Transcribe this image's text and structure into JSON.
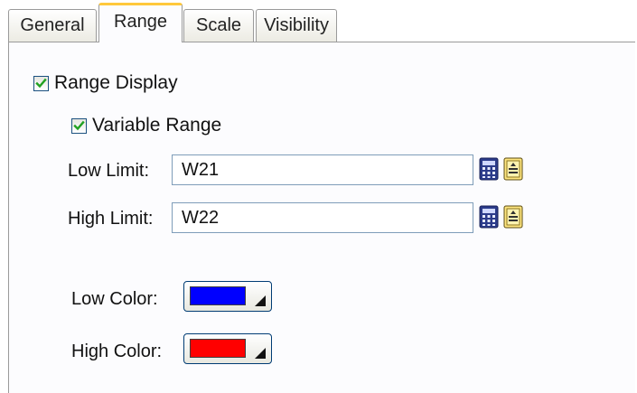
{
  "tabs": [
    {
      "label": "General",
      "active": false
    },
    {
      "label": "Range",
      "active": true
    },
    {
      "label": "Scale",
      "active": false
    },
    {
      "label": "Visibility",
      "active": false
    }
  ],
  "range_display": {
    "label": "Range Display",
    "checked": true
  },
  "variable_range": {
    "label": "Variable Range",
    "checked": true
  },
  "low_limit": {
    "label": "Low Limit:",
    "value": "W21"
  },
  "high_limit": {
    "label": "High Limit:",
    "value": "W22"
  },
  "low_color": {
    "label": "Low Color:",
    "color": "#0000ff"
  },
  "high_color": {
    "label": "High Color:",
    "color": "#ff0000"
  },
  "icons": [
    "calculator-icon",
    "tag-browser-icon"
  ]
}
